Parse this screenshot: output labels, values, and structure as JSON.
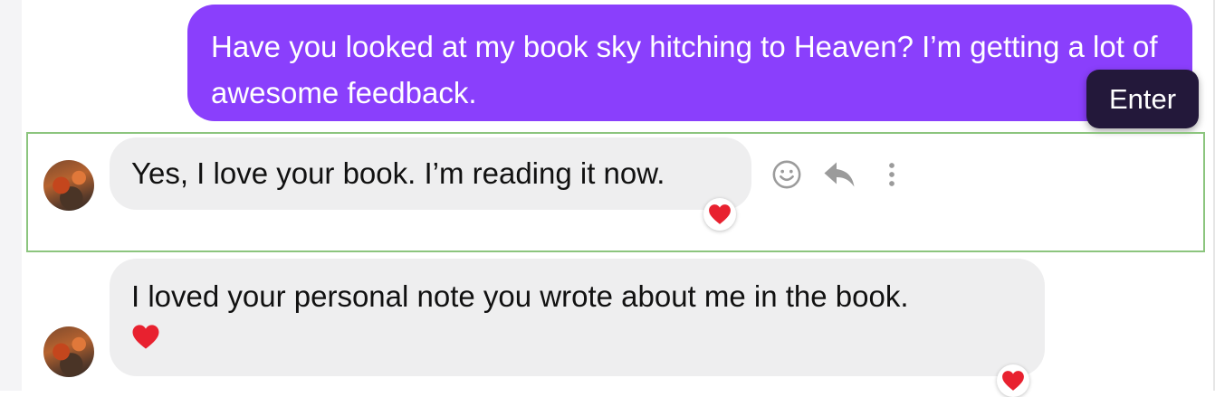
{
  "conversation": {
    "outgoing_message": "Have you looked at my book sky hitching to Heaven? I’m getting a lot of awesome feedback.",
    "tooltip": "Enter",
    "messages": [
      {
        "text": "Yes, I love your book. I’m reading it now.",
        "reaction": "heart-emoji"
      },
      {
        "text": "I loved your personal note you wrote about me in the book.",
        "inline_emoji": "heart-emoji",
        "reaction": "heart-emoji"
      }
    ]
  },
  "message_actions": [
    "smiley-icon",
    "reply-icon",
    "more-vertical-icon"
  ],
  "colors": {
    "outgoing_bubble": "#8a3ffc",
    "incoming_bubble": "#eeeeef",
    "tooltip_bg": "#23183a",
    "focus_outline": "#8cc57e",
    "heart": "#e8212f",
    "icon_gray": "#9b9b9b"
  }
}
